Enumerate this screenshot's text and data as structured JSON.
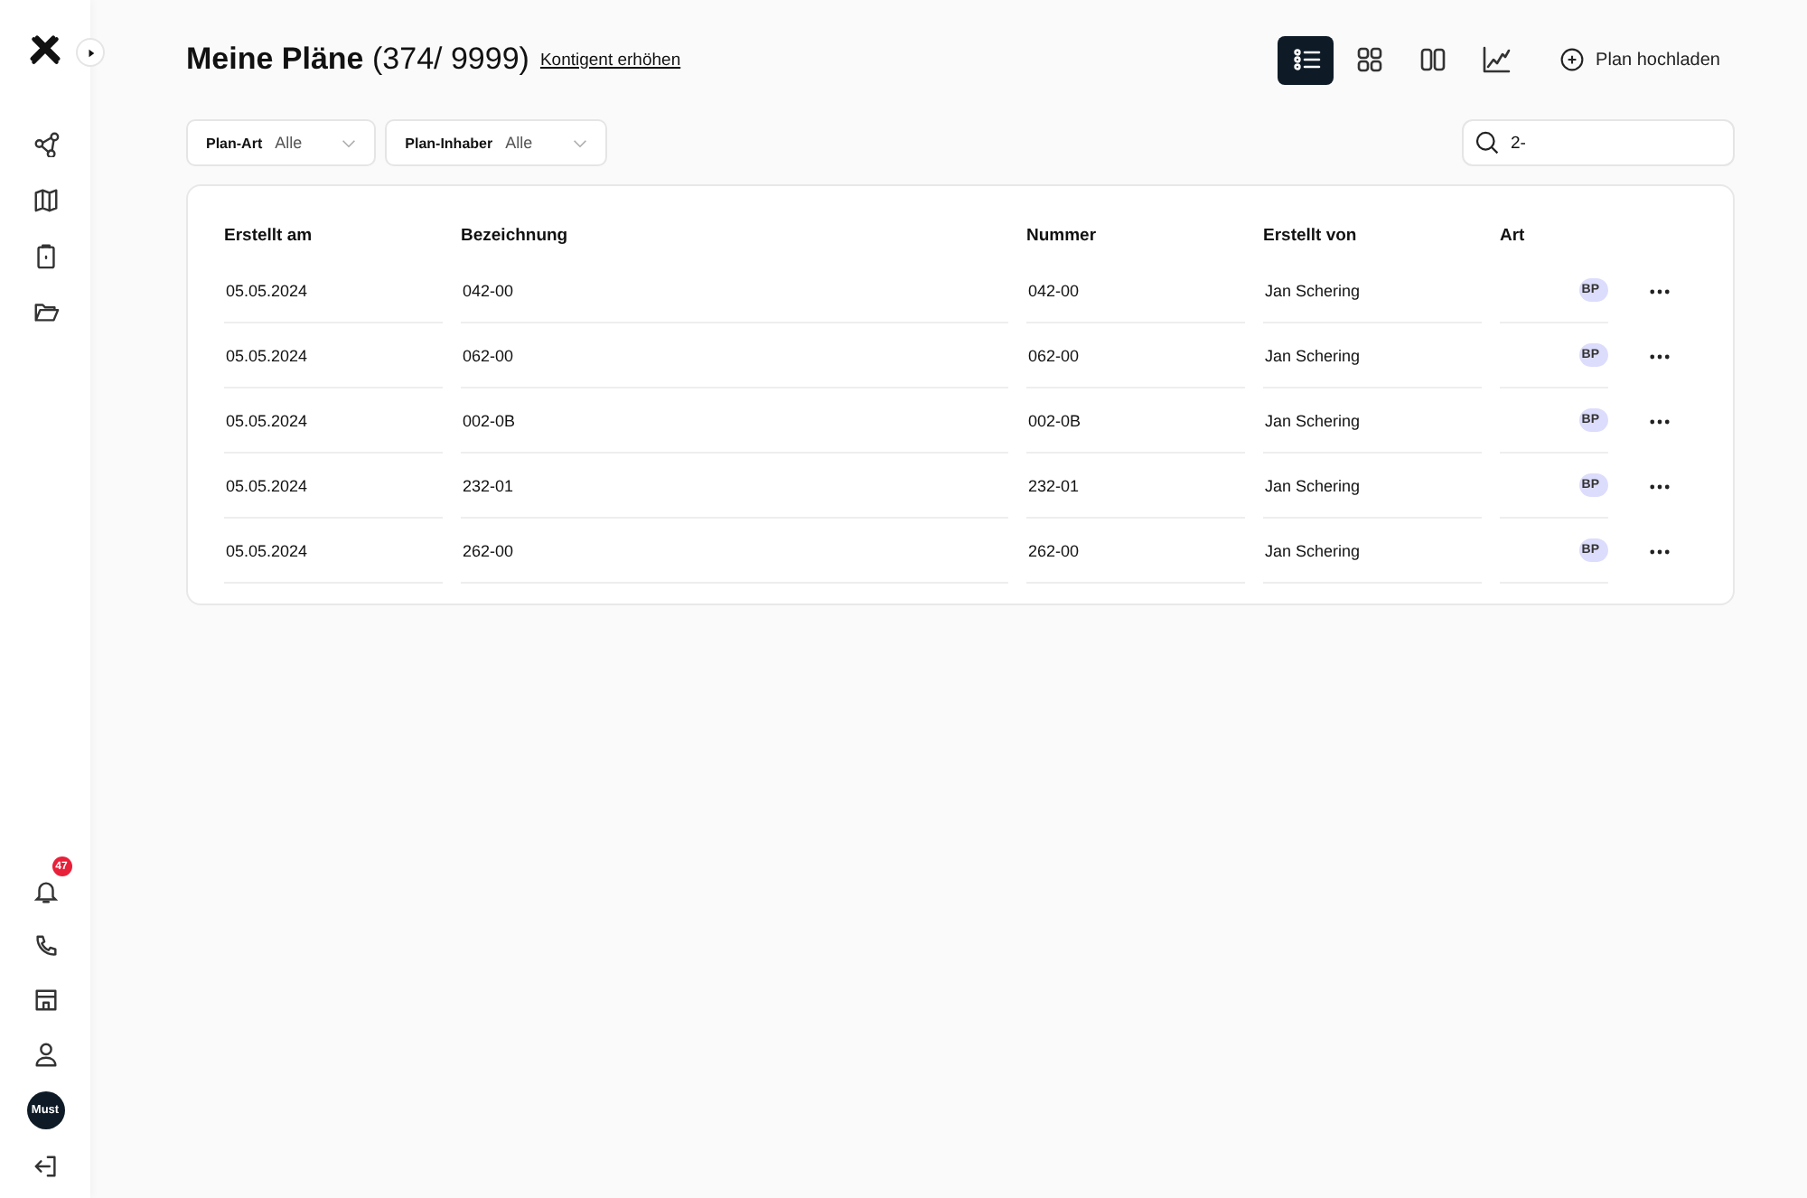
{
  "sidebar": {
    "top_items": [
      {
        "kind": "graph"
      },
      {
        "kind": "map"
      },
      {
        "kind": "clipboard"
      },
      {
        "kind": "folder"
      }
    ],
    "notifications_badge": "47",
    "bottom_items": [
      {
        "kind": "phone"
      },
      {
        "kind": "store"
      },
      {
        "kind": "user"
      }
    ],
    "avatar": "Must"
  },
  "header": {
    "title": "Meine Pläne",
    "count": "(374/ 9999)",
    "link": "Kontigent erhöhen",
    "views": [
      {
        "kind": "list",
        "selected": true
      },
      {
        "kind": "grid",
        "selected": false
      },
      {
        "kind": "columns",
        "selected": false
      },
      {
        "kind": "chart",
        "selected": false
      }
    ],
    "upload": "Plan hochladen"
  },
  "filters": [
    {
      "label": "Plan-Art",
      "value": "Alle"
    },
    {
      "label": "Plan-Inhaber",
      "value": "Alle"
    }
  ],
  "search": {
    "value": "2-"
  },
  "table": {
    "columns": [
      "Erstellt am",
      "Bezeichnung",
      "Nummer",
      "Erstellt von",
      "Art"
    ],
    "rows": [
      [
        "05.05.2024",
        "042-00",
        "042-00",
        "Jan Schering",
        "BP"
      ],
      [
        "05.05.2024",
        "062-00",
        "062-00",
        "Jan Schering",
        "BP"
      ],
      [
        "05.05.2024",
        "002-0B",
        "002-0B",
        "Jan Schering",
        "BP"
      ],
      [
        "05.05.2024",
        "232-01",
        "232-01",
        "Jan Schering",
        "BP"
      ],
      [
        "05.05.2024",
        "262-00",
        "262-00",
        "Jan Schering",
        "BP"
      ]
    ]
  }
}
